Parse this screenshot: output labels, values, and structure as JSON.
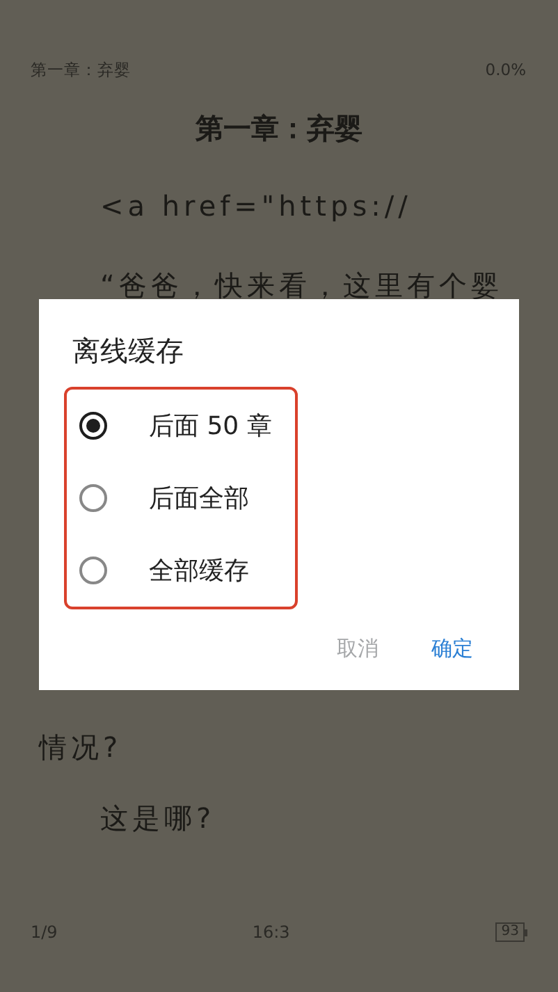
{
  "reader": {
    "header": {
      "chapter": "第一章：弃婴",
      "progress": "0.0%"
    },
    "chapter_title": "第一章：弃婴",
    "paragraphs": [
      {
        "text": "<a href=\"https://",
        "continued": false
      },
      {
        "text": "“爸爸，快来看，这里有个婴",
        "continued": false
      },
      {
        "text": "情况?",
        "continued": true
      },
      {
        "text": "这是哪?",
        "continued": false
      }
    ],
    "footer": {
      "page": "1/9",
      "time": "16:3",
      "battery": "93"
    }
  },
  "dialog": {
    "title": "离线缓存",
    "options": [
      {
        "label": "后面 50 章",
        "selected": true
      },
      {
        "label": "后面全部",
        "selected": false
      },
      {
        "label": "全部缓存",
        "selected": false
      }
    ],
    "buttons": [
      {
        "label": "取消",
        "kind": "cancel"
      },
      {
        "label": "确定",
        "kind": "confirm"
      }
    ]
  }
}
